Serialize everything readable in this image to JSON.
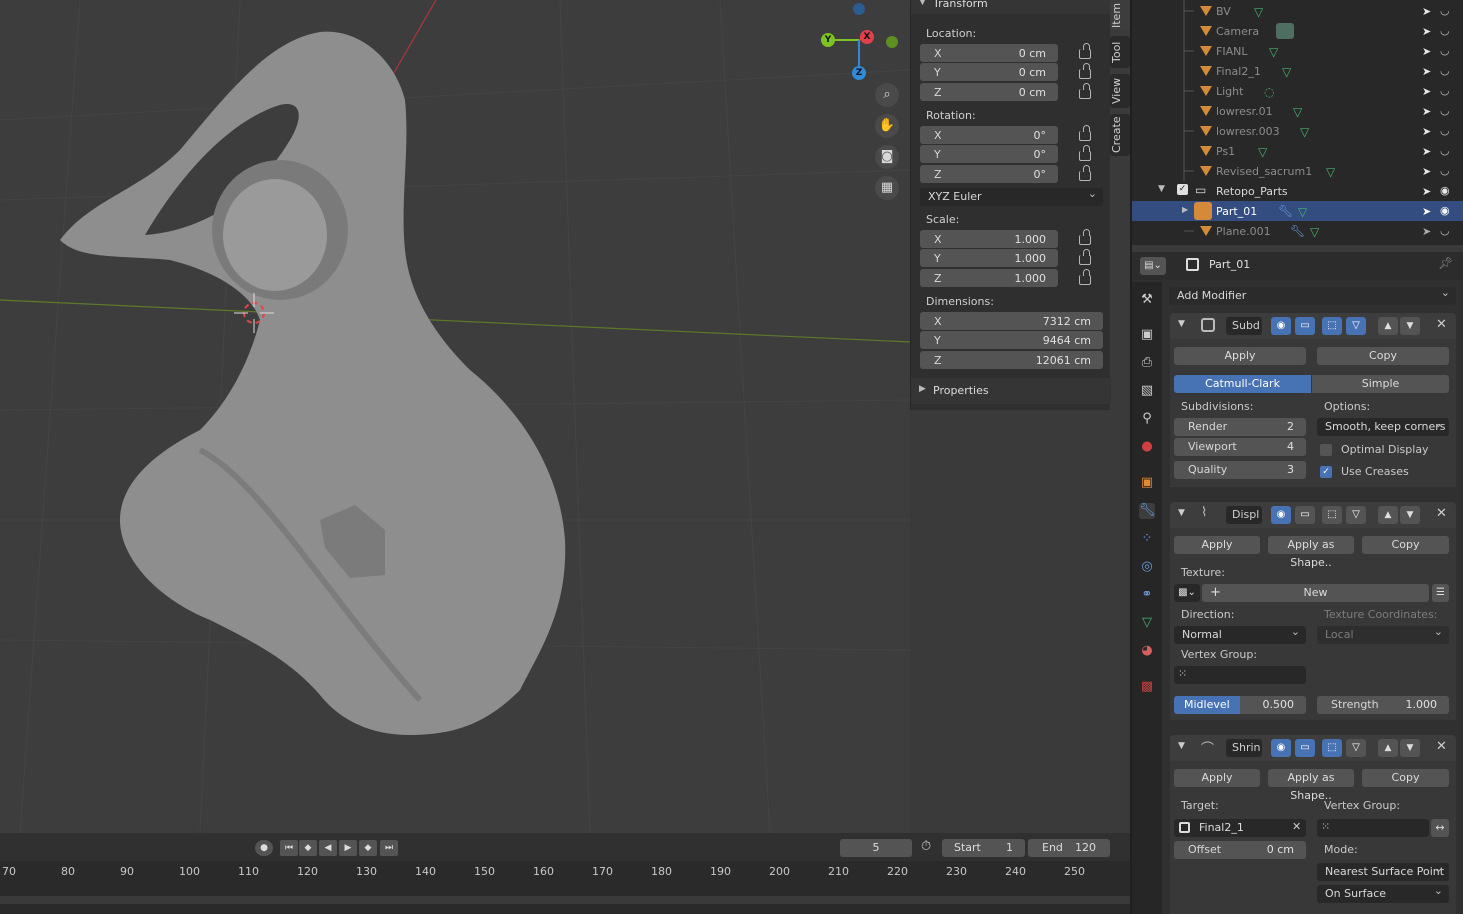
{
  "colors": {
    "accent": "#4772b3",
    "object_orange": "#d58a3a",
    "mesh_green": "#46b46e",
    "x_axis": "#e0404c",
    "y_axis": "#7ec322",
    "z_axis": "#2f8ad8"
  },
  "gizmo": {
    "x": "X",
    "y": "Y",
    "z": "Z"
  },
  "npanel": {
    "title": "Transform",
    "location_label": "Location:",
    "location": [
      {
        "axis": "X",
        "value": "0 cm"
      },
      {
        "axis": "Y",
        "value": "0 cm"
      },
      {
        "axis": "Z",
        "value": "0 cm"
      }
    ],
    "rotation_label": "Rotation:",
    "rotation": [
      {
        "axis": "X",
        "value": "0°"
      },
      {
        "axis": "Y",
        "value": "0°"
      },
      {
        "axis": "Z",
        "value": "0°"
      }
    ],
    "rotation_mode": "XYZ Euler",
    "scale_label": "Scale:",
    "scale": [
      {
        "axis": "X",
        "value": "1.000"
      },
      {
        "axis": "Y",
        "value": "1.000"
      },
      {
        "axis": "Z",
        "value": "1.000"
      }
    ],
    "dimensions_label": "Dimensions:",
    "dimensions": [
      {
        "axis": "X",
        "value": "7312 cm"
      },
      {
        "axis": "Y",
        "value": "9464 cm"
      },
      {
        "axis": "Z",
        "value": "12061 cm"
      }
    ],
    "properties_label": "Properties",
    "tabs": [
      "Item",
      "Tool",
      "View",
      "Create"
    ]
  },
  "outliner": {
    "items": [
      {
        "name": "BV"
      },
      {
        "name": "Camera"
      },
      {
        "name": "FIANL"
      },
      {
        "name": "Final2_1"
      },
      {
        "name": "Light"
      },
      {
        "name": "lowresr.01"
      },
      {
        "name": "lowresr.003"
      },
      {
        "name": "Ps1"
      },
      {
        "name": "Revised_sacrum1"
      },
      {
        "name": "Retopo_Parts"
      },
      {
        "name": "Part_01"
      },
      {
        "name": "Plane.001"
      }
    ]
  },
  "properties": {
    "object_name": "Part_01",
    "add_modifier": "Add Modifier",
    "subd": {
      "name": "Subd",
      "apply": "Apply",
      "copy": "Copy",
      "catmull": "Catmull-Clark",
      "simple": "Simple",
      "subdivisions_label": "Subdivisions:",
      "options_label": "Options:",
      "render_label": "Render",
      "render_value": "2",
      "viewport_label": "Viewport",
      "viewport_value": "4",
      "quality_label": "Quality",
      "quality_value": "3",
      "uv_smooth": "Smooth, keep corners",
      "optimal_display": "Optimal Display",
      "use_creases": "Use Creases"
    },
    "displ": {
      "name": "Displ",
      "apply": "Apply",
      "apply_shape": "Apply as Shape..",
      "copy": "Copy",
      "texture_label": "Texture:",
      "new": "New",
      "direction_label": "Direction:",
      "texcoords_label": "Texture Coordinates:",
      "direction": "Normal",
      "texcoords": "Local",
      "vertex_group_label": "Vertex Group:",
      "midlevel_label": "Midlevel",
      "midlevel_value": "0.500",
      "midlevel_fraction": 0.5,
      "strength_label": "Strength",
      "strength_value": "1.000"
    },
    "shrin": {
      "name": "Shrin",
      "apply": "Apply",
      "apply_shape": "Apply as Shape..",
      "copy": "Copy",
      "target_label": "Target:",
      "target": "Final2_1",
      "vertex_group_label": "Vertex Group:",
      "offset_label": "Offset",
      "offset_value": "0 cm",
      "mode_label": "Mode:",
      "mode": "Nearest Surface Point",
      "on_surface": "On Surface"
    }
  },
  "timeline": {
    "current_frame": "5",
    "start_label": "Start",
    "start": "1",
    "end_label": "End",
    "end": "120",
    "ticks": [
      "70",
      "80",
      "90",
      "100",
      "110",
      "120",
      "130",
      "140",
      "150",
      "160",
      "170",
      "180",
      "190",
      "200",
      "210",
      "220",
      "230",
      "240",
      "250"
    ]
  }
}
